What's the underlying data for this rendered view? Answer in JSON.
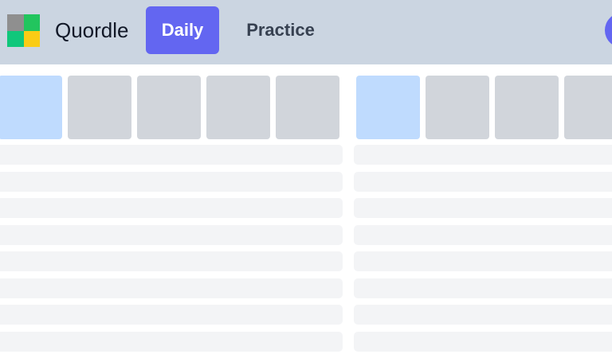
{
  "header": {
    "brand": "Quordle",
    "tabs": [
      {
        "label": "Daily",
        "active": true
      },
      {
        "label": "Practice",
        "active": false
      }
    ],
    "logo_colors": [
      "#8f8f8f",
      "#22c55e",
      "#10c77b",
      "#facc15"
    ],
    "accent_color": "#6366f1"
  },
  "boards": [
    {
      "tiles": 5,
      "active_tile": 0,
      "guess_rows": 8
    },
    {
      "tiles": 4,
      "active_tile": 0,
      "guess_rows": 8
    }
  ],
  "colors": {
    "header_bg": "#cbd5e1",
    "tile_empty": "#d1d5db",
    "tile_active": "#bfdbfe",
    "row_empty": "#f3f4f6"
  }
}
